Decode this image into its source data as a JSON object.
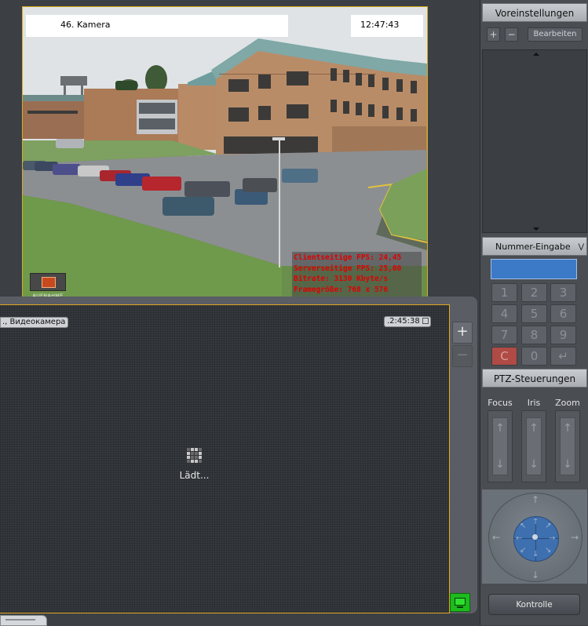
{
  "camera_main": {
    "title": "46. Kamera",
    "time": "12:47:43",
    "stats": [
      "Clientseitige FPS: 24,45",
      "Serverseitige FPS: 25,00",
      "Bitrate: 3130 Kbyte/s",
      "Framegröße: 768 x 576"
    ],
    "record_label": "AUFNAHME",
    "frame_color": "#d7ad1c"
  },
  "camera_second": {
    "name": "., Видеокамера",
    "time": ".2:45:38",
    "loading_text": "Lädt...",
    "frame_color": "#e0a920"
  },
  "zoom": {
    "plus": "+",
    "minus": "−"
  },
  "panel": {
    "presets_header": "Voreinstellungen",
    "add_label": "+",
    "remove_label": "−",
    "edit_label": "Bearbeiten",
    "number_header": "Nummer-Eingabe",
    "keypad": [
      "1",
      "2",
      "3",
      "4",
      "5",
      "6",
      "7",
      "8",
      "9",
      "C",
      "0",
      "↵"
    ],
    "ptz_header": "PTZ-Steuerungen",
    "ptz_labels": {
      "focus": "Focus",
      "iris": "Iris",
      "zoom": "Zoom"
    },
    "control_button": "Kontrolle"
  },
  "icons": {
    "record": "record-icon",
    "monitor": "monitor-icon",
    "loading": "loading-icon",
    "expand": "chevron-double-down-icon"
  },
  "colors": {
    "number_display": "#3c7ac8",
    "clear_key": "#b04a44",
    "monitor_active": "#1dbb1d",
    "joystick_center": "#3e6fae"
  }
}
